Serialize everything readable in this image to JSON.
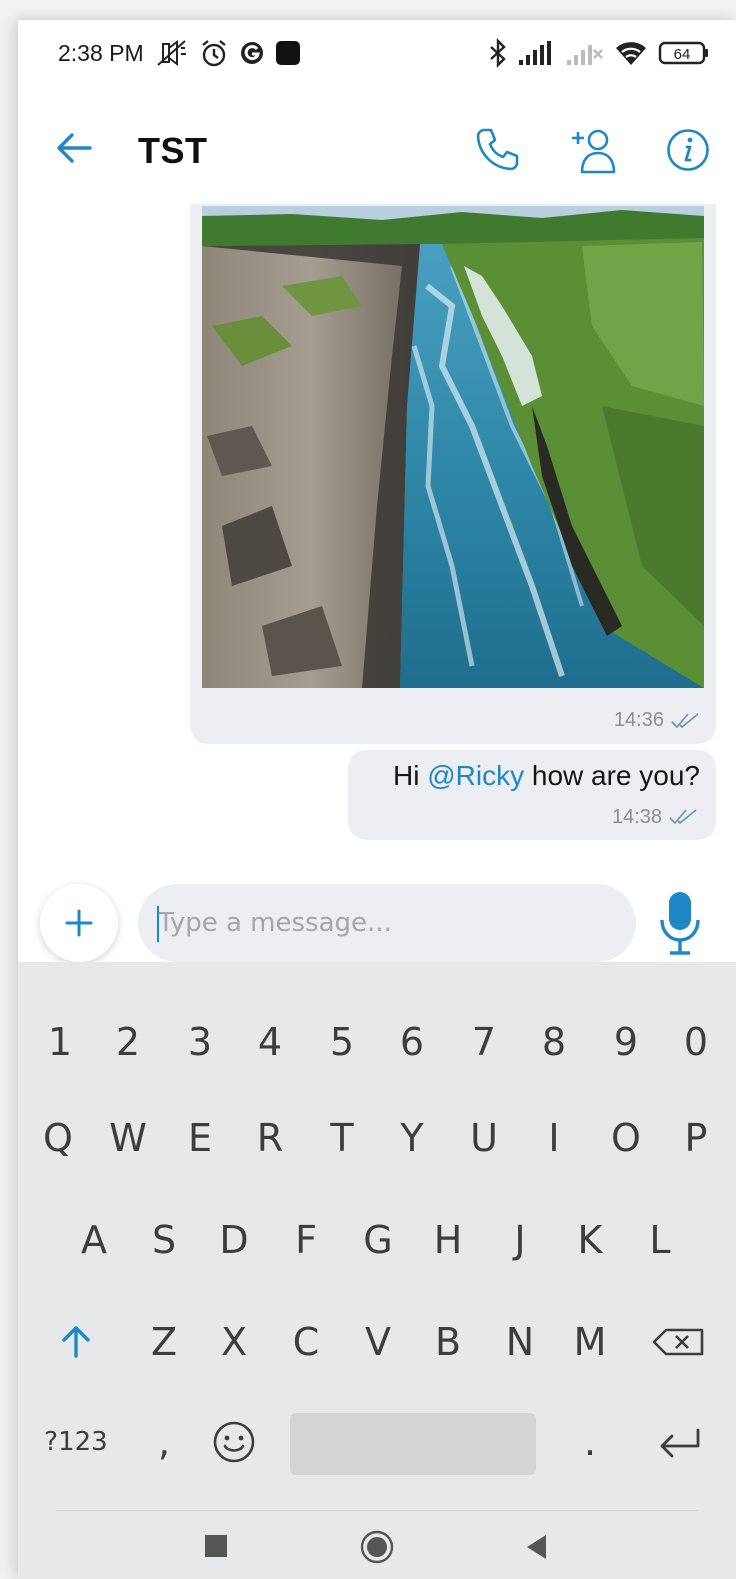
{
  "status_bar": {
    "time": "2:38 PM",
    "left_icons": [
      "mute-vibrate-icon",
      "alarm-icon",
      "g-icon",
      "square-app-icon"
    ],
    "right_icons": [
      "bluetooth-icon",
      "signal-icon",
      "signal-no-service-icon",
      "wifi-icon",
      "battery-icon"
    ],
    "battery": "64"
  },
  "header": {
    "title": "TST",
    "accent_color": "#1e88c7"
  },
  "messages": [
    {
      "type": "image",
      "time": "14:36",
      "status": "read"
    },
    {
      "type": "text",
      "prefix": "Hi ",
      "mention": "@Ricky",
      "suffix": " how are you?",
      "time": "14:38",
      "status": "read"
    }
  ],
  "composer": {
    "placeholder": "Type a message..."
  },
  "keyboard": {
    "numbers": [
      "1",
      "2",
      "3",
      "4",
      "5",
      "6",
      "7",
      "8",
      "9",
      "0"
    ],
    "row1": [
      "Q",
      "W",
      "E",
      "R",
      "T",
      "Y",
      "U",
      "I",
      "O",
      "P"
    ],
    "row2": [
      "A",
      "S",
      "D",
      "F",
      "G",
      "H",
      "J",
      "K",
      "L"
    ],
    "row3": [
      "Z",
      "X",
      "C",
      "V",
      "B",
      "N",
      "M"
    ],
    "symbols_label": "?123",
    "comma": ",",
    "period": "."
  }
}
